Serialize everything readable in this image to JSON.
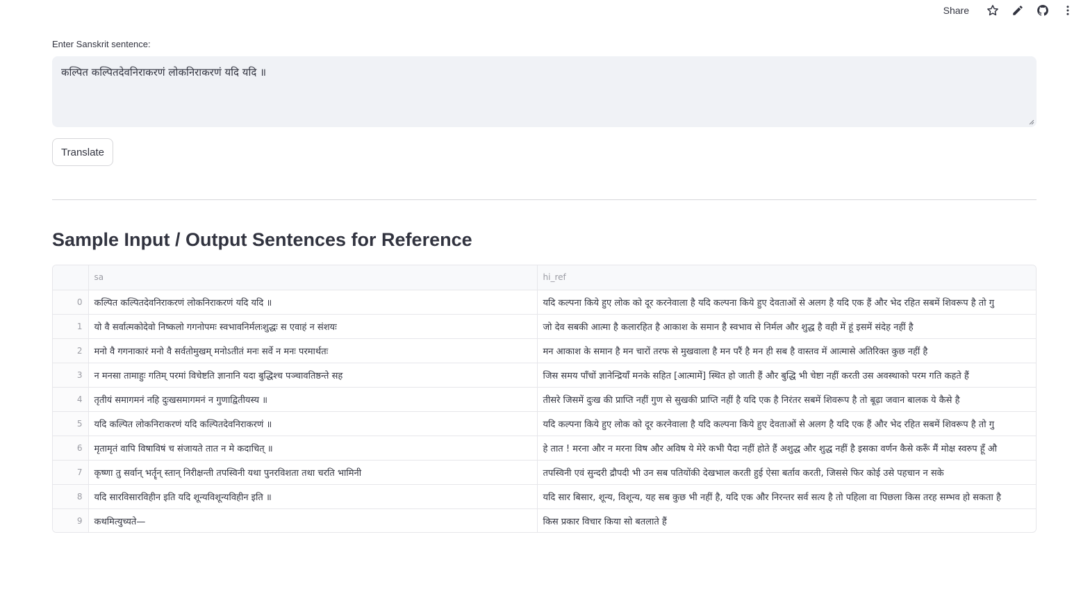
{
  "header": {
    "share_label": "Share",
    "icons": [
      "star-icon",
      "edit-icon",
      "github-icon",
      "more-vertical-icon"
    ]
  },
  "form": {
    "label": "Enter Sanskrit sentence:",
    "value": "कल्पित कल्पितदेवनिराकरणं लोकनिराकरणं यदि यदि ॥",
    "button_label": "Translate"
  },
  "section": {
    "heading": "Sample Input / Output Sentences for Reference"
  },
  "table": {
    "columns": [
      "",
      "sa",
      "hi_ref"
    ],
    "rows": [
      {
        "index": "0",
        "sa": "कल्पित कल्पितदेवनिराकरणं लोकनिराकरणं यदि यदि ॥",
        "hi_ref": "यदि कल्पना किये हुए लोक को दूर करनेवाला है यदि कल्पना किये हुए देवताओं से अलग है यदि एक हैं और भेद रहित सबमें शिवरूप है तो गु"
      },
      {
        "index": "1",
        "sa": "यो वै सर्वात्मकोदेवो निष्कलो गगनोपमः स्वभावनिर्मलःशुद्धः स एवाहं न संशयः",
        "hi_ref": "जो देव सबकी आत्मा है कलारहित है आकाश के समान है स्वभाव से निर्मल और शुद्ध है वही में हूं इसमें संदेह नहीं है"
      },
      {
        "index": "2",
        "sa": "मनो वै गगनाकारं मनो वै सर्वतोमुखम् मनोऽतीतं मनः सर्वे न मनः परमार्थतः",
        "hi_ref": "मन आकाश के समान है मन चारों तरफ से मुखवाला है मन परैं है मन ही सब है वास्तव में आत्मासे अतिरिक्त कुछ नहीं है"
      },
      {
        "index": "3",
        "sa": "न मनसा तामाहुः गतिम् परमां विचेष्टति ज्ञानानि यदा बुद्धिश्च पञ्चावतिष्ठन्ते सह",
        "hi_ref": "जिस समय पाँचों ज्ञानेन्द्रियाँ मनके सहित [आत्मामें] स्थित हो जाती हैं और बुद्धि भी चेष्टा नहीं करती उस अवस्थाको परम गति कहते हैं"
      },
      {
        "index": "4",
        "sa": "तृतीयं समागमनं नहि दुःखसमागमनं न गुणाद्वितीयस्य ॥",
        "hi_ref": "तीसरे जिसमें दुःख की प्राप्ति नहीं गुण से सुखकी प्राप्ति नहीं है यदि एक है निरंतर सबमें शिवरूप है तो बूढ़ा जवान बालक ये कैसे है"
      },
      {
        "index": "5",
        "sa": "यदि कल्पित लोकनिराकरणं यदि कल्पितदेवनिराकरणं ॥",
        "hi_ref": "यदि कल्पना किये हुए लोक को दूर करनेवाला है यदि कल्पना किये हुए देवताओं से अलग है यदि एक हैं और भेद रहित सबमें शिवरूप है तो गु"
      },
      {
        "index": "6",
        "sa": "मृतामृतं वापि विषाविषं च संजायते तात न मे कदाचित् ॥",
        "hi_ref": "हे तात ! मरना और न मरना विष और अविष ये मेरे कभी पैदा नहीं होते हैं अशुद्ध और शुद्ध नहीं है इसका वर्णन कैसे करूँ मैं मोक्ष स्वरुप हूँ औ"
      },
      {
        "index": "7",
        "sa": "कृष्णा तु सर्वान् भर्तॄन् स्तान् निरीक्षन्ती तपस्विनी यथा पुनरविशता तथा चरति भामिनी",
        "hi_ref": "तपस्विनी एवं सुन्दरी द्रौपदी भी उन सब पतियोंकी देखभाल करती हुई ऐसा बर्ताव करती, जिससे फिर कोई उसे पहचान न सके"
      },
      {
        "index": "8",
        "sa": "यदि सारविसारविहीन इति यदि शून्यविशून्यविहीन इति ॥",
        "hi_ref": "यदि सार बिसार, शून्य, विशून्य, यह सब कुछ भी नहीं है, यदि एक और निरन्तर सर्व सत्य है तो पहिला वा पिछला किस तरह सम्भव हो सकता है"
      },
      {
        "index": "9",
        "sa": "कथमित्युच्यते—",
        "hi_ref": "किस प्रकार विचार किया सो बतलाते हैं"
      }
    ]
  }
}
